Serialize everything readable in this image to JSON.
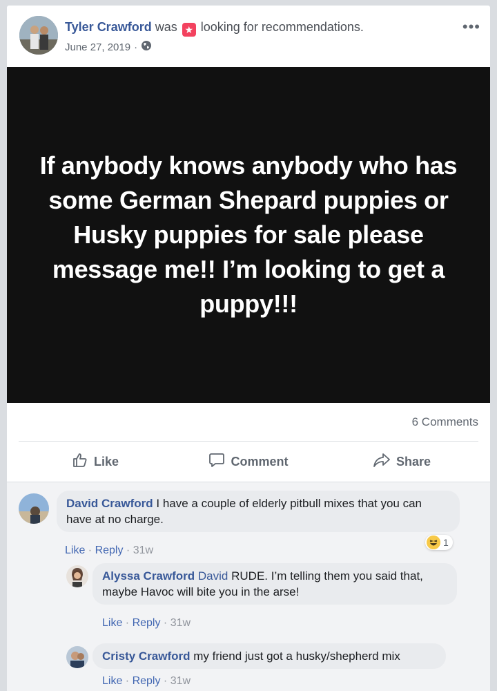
{
  "post": {
    "author": "Tyler Crawford",
    "status_prefix": "was",
    "status_text": "looking for recommendations.",
    "date": "June 27, 2019",
    "separator": "·",
    "more_label": "•••",
    "image_text": "If anybody knows anybody who has some German Shepard puppies or Husky puppies for sale please message me!! I’m looking to get a puppy!!!",
    "comments_count": "6 Comments"
  },
  "actions": {
    "like": "Like",
    "comment": "Comment",
    "share": "Share"
  },
  "comments": [
    {
      "author": "David Crawford",
      "text": "I have a couple of elderly pitbull mixes that you can have at no charge.",
      "like": "Like",
      "reply": "Reply",
      "age": "31w",
      "reaction_count": "1"
    },
    {
      "author": "Alyssa Crawford",
      "tag": "David",
      "text": "RUDE. I’m telling them you said that, maybe Havoc will bite you in the arse!",
      "like": "Like",
      "reply": "Reply",
      "age": "31w"
    },
    {
      "author": "Cristy Crawford",
      "text": "my friend just got a husky/shepherd mix",
      "like": "Like",
      "reply": "Reply",
      "age": "31w"
    }
  ],
  "meta_sep": " · ",
  "colors": {
    "link": "#385898",
    "recommendation_badge": "#f3425f",
    "image_bg": "#111111"
  }
}
